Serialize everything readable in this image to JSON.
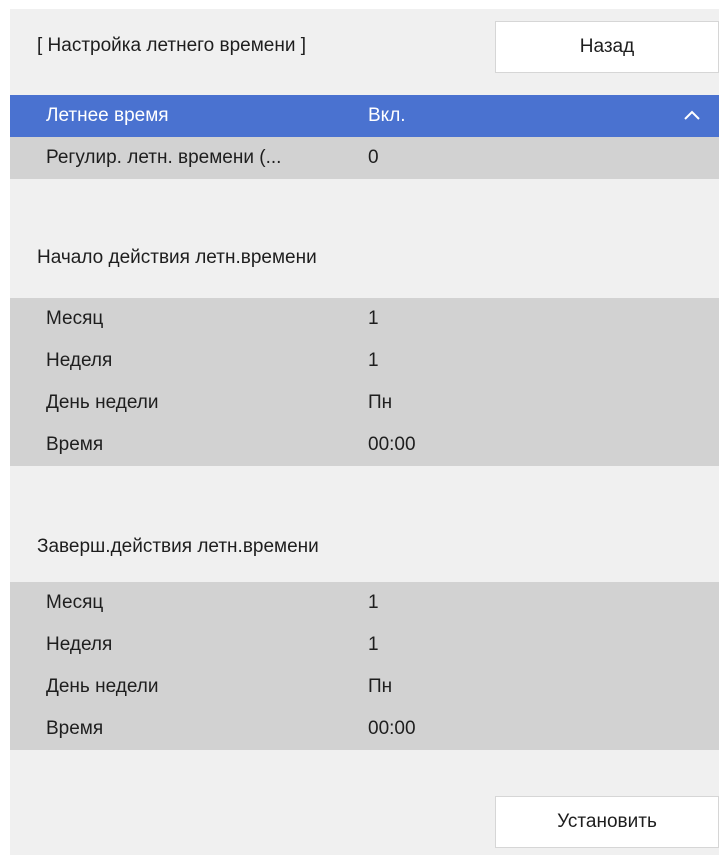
{
  "header": {
    "title": "[ Настройка летнего времени ]",
    "back_label": "Назад"
  },
  "top_rows": [
    {
      "label": "Летнее время",
      "value": "Вкл."
    },
    {
      "label": "Регулир. летн. времени (...",
      "value": "0"
    }
  ],
  "start_section": {
    "title": "Начало действия летн.времени",
    "rows": [
      {
        "label": "Месяц",
        "value": "1"
      },
      {
        "label": "Неделя",
        "value": "1"
      },
      {
        "label": "День недели",
        "value": "Пн"
      },
      {
        "label": "Время",
        "value": "00:00"
      }
    ]
  },
  "end_section": {
    "title": "Заверш.действия летн.времени",
    "rows": [
      {
        "label": "Месяц",
        "value": "1"
      },
      {
        "label": "Неделя",
        "value": "1"
      },
      {
        "label": "День недели",
        "value": "Пн"
      },
      {
        "label": "Время",
        "value": "00:00"
      }
    ]
  },
  "footer": {
    "set_label": "Установить"
  },
  "colors": {
    "selected_row": "#4a72d0",
    "row_bg": "#d2d2d2",
    "panel_bg": "#f0f0f0"
  }
}
